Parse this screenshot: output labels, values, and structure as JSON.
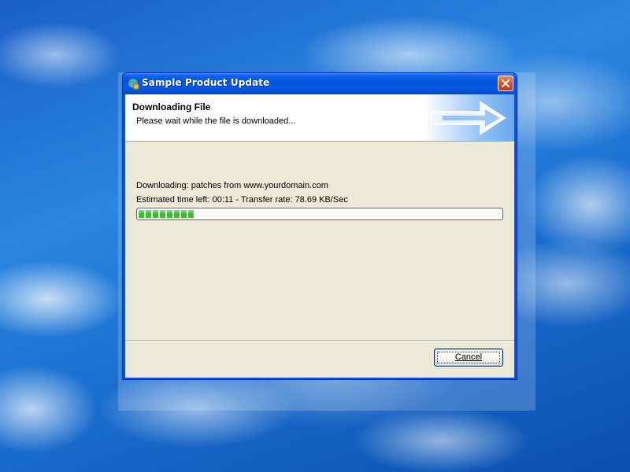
{
  "window": {
    "title": "Sample Product Update",
    "title_icon": "update-app-icon",
    "close_icon": "close-icon"
  },
  "header": {
    "title": "Downloading File",
    "subtitle": "Please wait while the file is downloaded...",
    "art_icon": "arrow-right-icon"
  },
  "body": {
    "status_download": "Downloading: patches from www.yourdomain.com",
    "status_time": "Estimated time left: 00:11 - Transfer rate: 78.69 KB/Sec",
    "progress_fraction": 0.15
  },
  "buttons": {
    "cancel_label": "Cancel"
  },
  "colors": {
    "titlebar": "#0654df",
    "progress_green": "#38c02c",
    "dialog_face": "#ece9d8",
    "close_red": "#d8532b"
  }
}
